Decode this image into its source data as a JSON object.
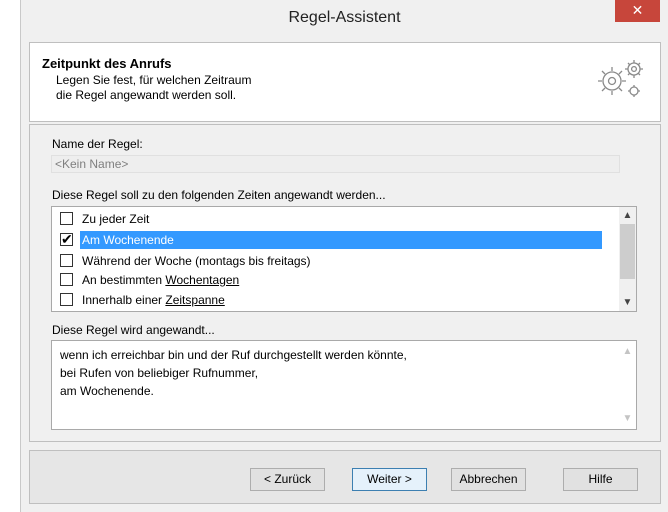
{
  "window": {
    "title": "Regel-Assistent",
    "close_symbol": "✕"
  },
  "header": {
    "title": "Zeitpunkt des Anrufs",
    "desc_line1": "Legen Sie fest, für welchen Zeitraum",
    "desc_line2": "die Regel angewandt werden soll."
  },
  "name": {
    "label": "Name der Regel:",
    "value": "<Kein Name>"
  },
  "times": {
    "label": "Diese Regel soll zu den folgenden Zeiten angewandt werden...",
    "items": [
      {
        "pre": "Zu ",
        "ul": "j",
        "post": "eder Zeit",
        "checked": false,
        "selected": false
      },
      {
        "pre": "Am Wochenende",
        "ul": "",
        "post": "",
        "checked": true,
        "selected": true
      },
      {
        "pre": "Während der Woche (montags bis freitags)",
        "ul": "",
        "post": "",
        "checked": false,
        "selected": false
      },
      {
        "pre": "An bestimmten ",
        "ul": "Wochentagen",
        "post": "",
        "checked": false,
        "selected": false
      },
      {
        "pre": "Innerhalb einer ",
        "ul": "Zeitspanne",
        "post": "",
        "checked": false,
        "selected": false
      }
    ]
  },
  "summary": {
    "label": "Diese Regel wird angewandt...",
    "line1": "wenn ich erreichbar bin und der Ruf durchgestellt werden könnte,",
    "line2": "bei Rufen von beliebiger Rufnummer,",
    "line3": "am Wochenende."
  },
  "buttons": {
    "back": "< Zurück",
    "next": "Weiter >",
    "cancel": "Abbrechen",
    "help": "Hilfe"
  }
}
